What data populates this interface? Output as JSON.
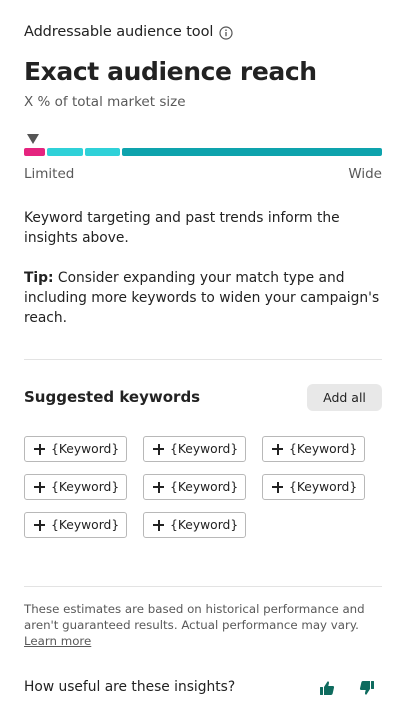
{
  "header": {
    "tool_title": "Addressable audience tool",
    "info_icon": "info-icon",
    "headline": "Exact audience reach",
    "subline": "X % of total market size"
  },
  "meter": {
    "marker_icon": "triangle-down-icon",
    "segment_colors": [
      "#e5247f",
      "#2fd1d8",
      "#2fd1d8",
      "#0ea3ad"
    ],
    "left_label": "Limited",
    "right_label": "Wide"
  },
  "description": {
    "text": "Keyword targeting and past trends inform the insights above.",
    "tip_label": "Tip:",
    "tip_text": " Consider expanding your match type and including more keywords to widen your campaign's reach."
  },
  "suggested": {
    "title": "Suggested keywords",
    "add_all_label": "Add all",
    "chips": [
      "{Keyword}",
      "{Keyword}",
      "{Keyword}",
      "{Keyword}",
      "{Keyword}",
      "{Keyword}",
      "{Keyword}",
      "{Keyword}"
    ]
  },
  "footer": {
    "disclaimer": "These estimates are based on historical performance and aren't guaranteed results. Actual performance may vary.",
    "learn_more": "Learn more",
    "feedback_question": "How useful are these insights?",
    "thumbs_up_icon": "thumbs-up-icon",
    "thumbs_down_icon": "thumbs-down-icon",
    "thumb_color": "#0e6b5e"
  }
}
